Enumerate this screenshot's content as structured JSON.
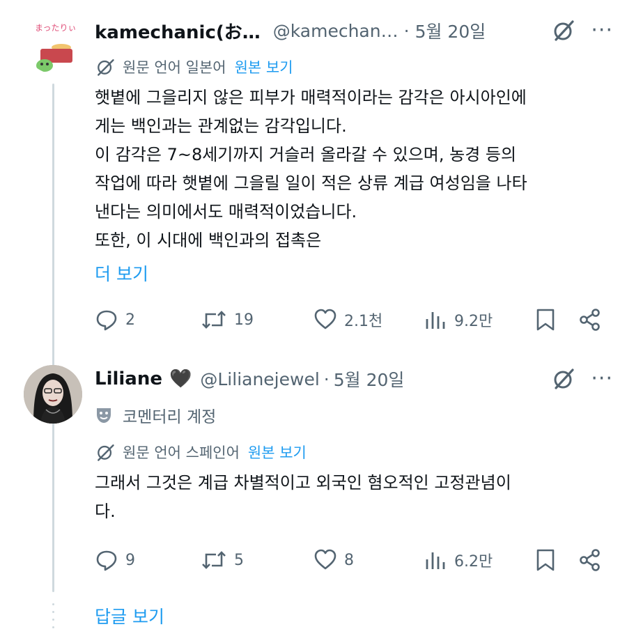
{
  "post1": {
    "author_name": "kamechanic(お…",
    "author_handle": "@kamechan…",
    "date": "5월 20일",
    "avatar_text": "まったりぃ",
    "translate": {
      "label": "원문 언어 일본어",
      "link": "원본 보기"
    },
    "text_lines": [
      "햇볕에 그을리지 않은 피부가 매력적이라는 감각은 아시아인에",
      "게는 백인과는 관계없는 감각입니다.",
      "이 감각은 7~8세기까지 거슬러 올라갈 수 있으며, 농경 등의",
      "작업에 따라 햇볕에 그을릴 일이 적은 상류 계급 여성임을 나타",
      "낸다는 의미에서도 매력적이었습니다.",
      "또한, 이 시대에 백인과의 접촉은"
    ],
    "show_more": "더 보기",
    "stats": {
      "replies": "2",
      "reposts": "19",
      "likes": "2.1천",
      "views": "9.2만"
    }
  },
  "post2": {
    "author_name": "Liliane",
    "author_emoji": "🖤",
    "author_handle": "@Lilianejewel",
    "date": "5월 20일",
    "commentary_label": "코멘터리 계정",
    "translate": {
      "label": "원문 언어 스페인어",
      "link": "원본 보기"
    },
    "text_lines": [
      "그래서 그것은 계급 차별적이고 외국인 혐오적인 고정관념이",
      "다."
    ],
    "stats": {
      "replies": "9",
      "reposts": "5",
      "likes": "8",
      "views": "6.2만"
    }
  },
  "show_replies": "답글 보기",
  "icons": {
    "grok": "slashed-circle-icon",
    "more": "more-icon",
    "reply": "reply-icon",
    "repost": "repost-icon",
    "like": "heart-icon",
    "views": "views-icon",
    "bookmark": "bookmark-icon",
    "share": "share-icon",
    "translate": "translate-icon",
    "commentary": "theater-mask-icon"
  },
  "colors": {
    "link": "#1d9bf0",
    "secondary": "#536471",
    "text": "#0f1419",
    "thread_line": "#cfd9de"
  }
}
